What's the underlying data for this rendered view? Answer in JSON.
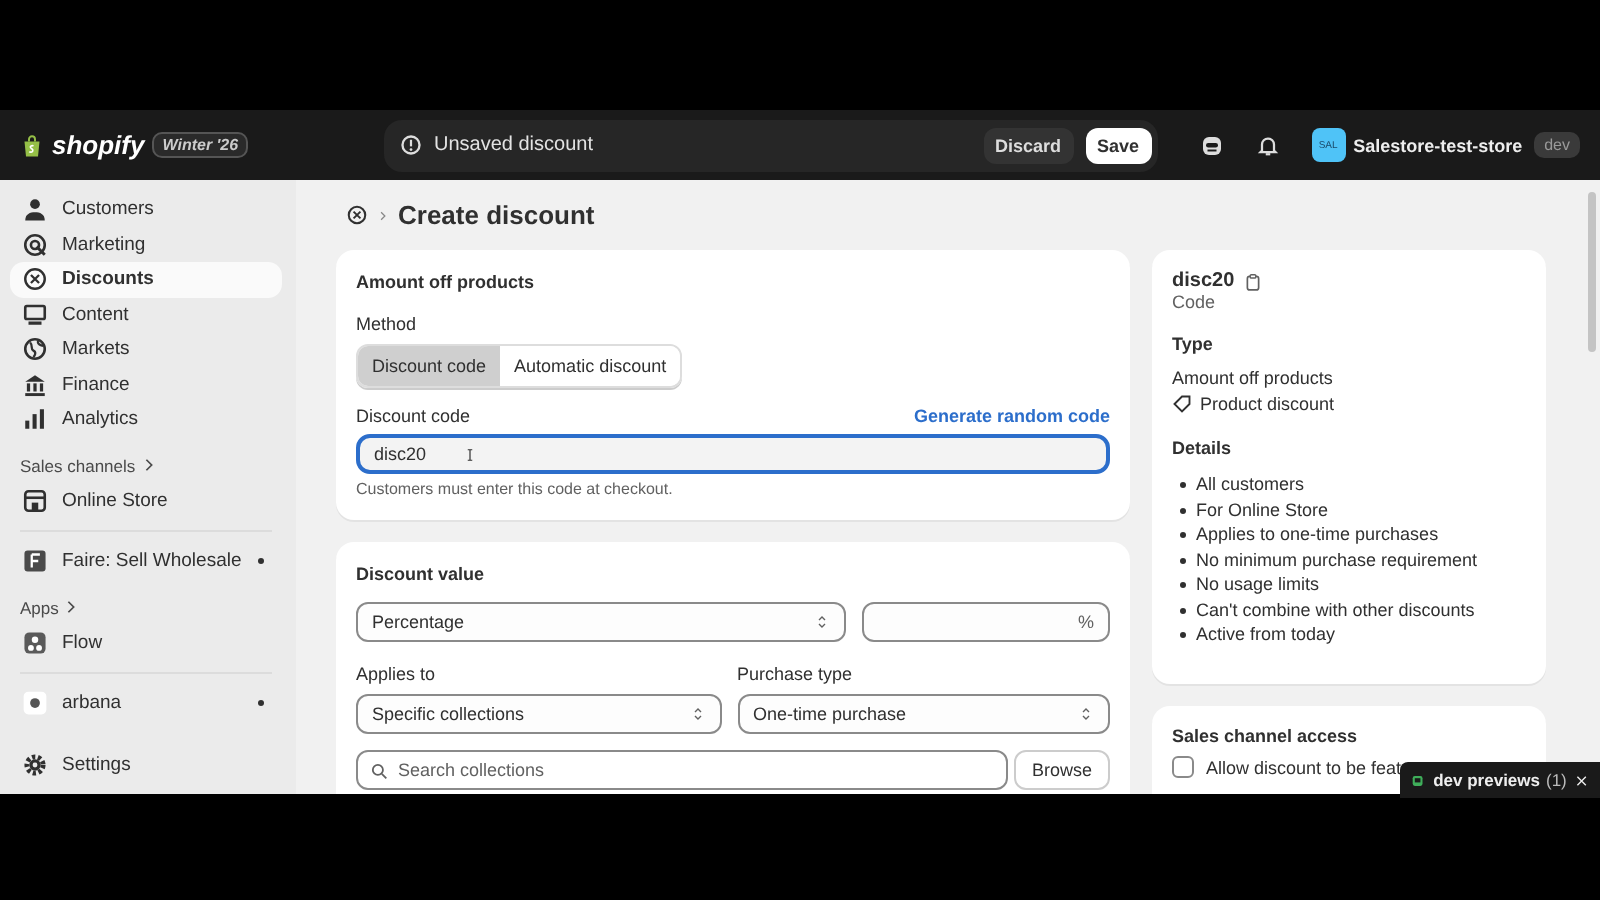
{
  "topbar": {
    "logo": "shopify",
    "edition": "Winter '26",
    "banner": "Unsaved discount",
    "buttons": [
      {
        "label": "Discard",
        "kind": "secondary"
      },
      {
        "label": "Save",
        "kind": "primary"
      }
    ],
    "store": {
      "initials": "SAL",
      "name": "Salestore-test-store",
      "badge": "dev"
    }
  },
  "sidebar": {
    "entries": [
      {
        "kind": "item",
        "label": "Customers",
        "selected": false,
        "pinned": false
      },
      {
        "kind": "item",
        "label": "Marketing",
        "selected": false,
        "pinned": false
      },
      {
        "kind": "item",
        "label": "Discounts",
        "selected": true,
        "pinned": false
      },
      {
        "kind": "item",
        "label": "Content",
        "selected": false,
        "pinned": false
      },
      {
        "kind": "item",
        "label": "Markets",
        "selected": false,
        "pinned": false
      },
      {
        "kind": "item",
        "label": "Finance",
        "selected": false,
        "pinned": false
      },
      {
        "kind": "item",
        "label": "Analytics",
        "selected": false,
        "pinned": false
      },
      {
        "kind": "heading",
        "label": "Sales channels"
      },
      {
        "kind": "item",
        "label": "Online Store",
        "selected": false,
        "pinned": false
      },
      {
        "kind": "divider"
      },
      {
        "kind": "item",
        "label": "Faire: Sell Wholesale",
        "selected": false,
        "pinned": true
      },
      {
        "kind": "heading",
        "label": "Apps"
      },
      {
        "kind": "item",
        "label": "Flow",
        "selected": false,
        "pinned": false
      },
      {
        "kind": "divider"
      },
      {
        "kind": "item",
        "label": "arbana",
        "selected": false,
        "pinned": true
      }
    ],
    "footer": {
      "label": "Settings"
    }
  },
  "page": {
    "title": "Create discount"
  },
  "method_card": {
    "title": "Amount off products",
    "method_label": "Method",
    "options": [
      {
        "label": "Discount code",
        "selected": true
      },
      {
        "label": "Automatic discount",
        "selected": false
      }
    ],
    "code_label": "Discount code",
    "generate": "Generate random code",
    "code_value": "disc20",
    "help": "Customers must enter this code at checkout."
  },
  "value_card": {
    "title": "Discount value",
    "value_type": "Percentage",
    "amount_suffix": "%",
    "applies_label": "Applies to",
    "applies_value": "Specific collections",
    "purchase_label": "Purchase type",
    "purchase_value": "One-time purchase",
    "search_placeholder": "Search collections",
    "browse": "Browse"
  },
  "summary": {
    "code": "disc20",
    "code_caption": "Code",
    "type_heading": "Type",
    "type": "Amount off products",
    "type_tag": "Product discount",
    "details_heading": "Details",
    "details": [
      "All customers",
      "For Online Store",
      "Applies to one-time purchases",
      "No minimum purchase requirement",
      "No usage limits",
      "Can't combine with other discounts",
      "Active from today"
    ]
  },
  "sales_channel": {
    "title": "Sales channel access",
    "option": {
      "label": "Allow discount to be feat",
      "checked": false
    }
  },
  "toast": {
    "label": "dev previews",
    "count": "(1)"
  }
}
